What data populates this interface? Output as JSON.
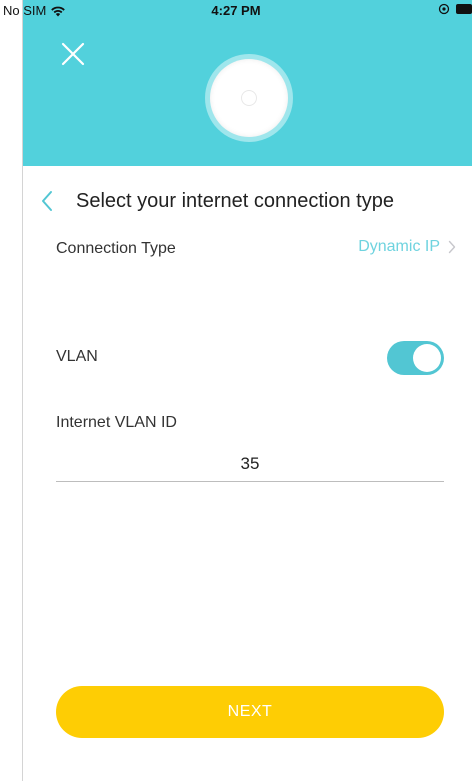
{
  "status_bar": {
    "carrier": "No SIM",
    "time": "4:27 PM"
  },
  "header": {
    "background_color": "#52d1dc",
    "close_icon": "close-icon",
    "device_icon": "access-point-icon"
  },
  "page": {
    "title": "Select your internet connection type",
    "back_icon": "chevron-left-icon"
  },
  "connection_type": {
    "label": "Connection Type",
    "value": "Dynamic IP",
    "value_color": "#6fd3df"
  },
  "vlan": {
    "label": "VLAN",
    "enabled": true,
    "toggle_color": "#52c6d3"
  },
  "vlan_id": {
    "label": "Internet VLAN ID",
    "value": "35"
  },
  "next_button": {
    "label": "NEXT",
    "color": "#fecd04"
  }
}
